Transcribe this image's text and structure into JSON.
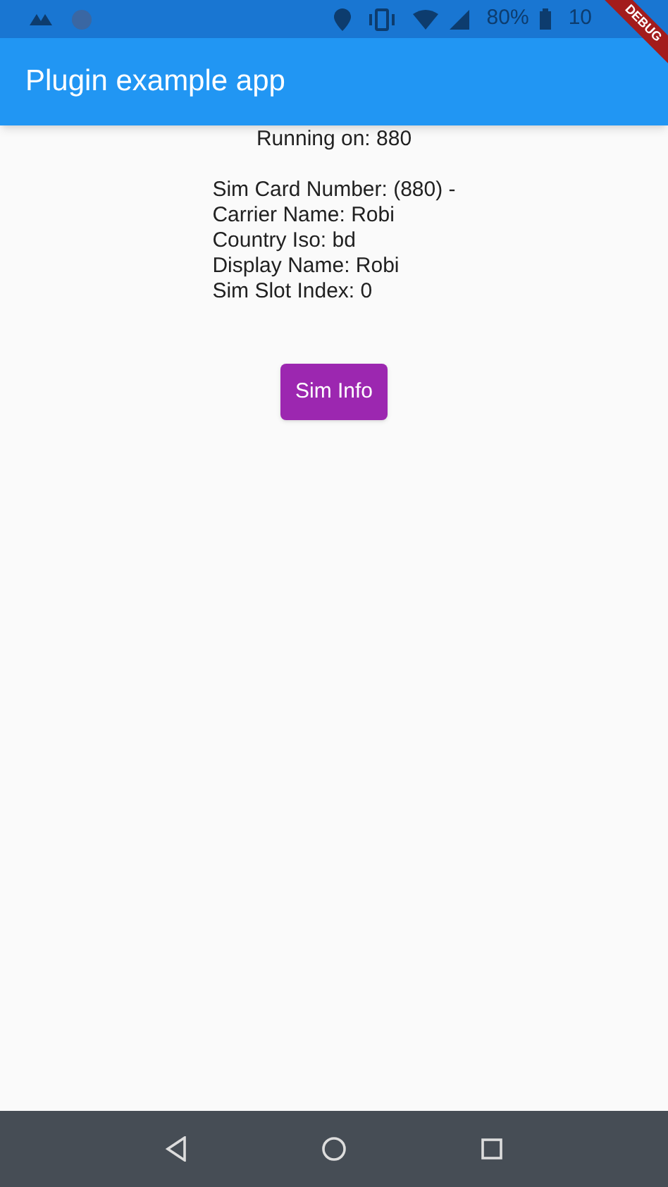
{
  "status_bar": {
    "battery": "80%",
    "time": "10"
  },
  "debug_banner": "DEBUG",
  "app_bar": {
    "title": "Plugin example app"
  },
  "running_on": "Running on: 880",
  "sim_info": [
    "Sim Card Number: (880) -",
    "Carrier Name: Robi",
    "Country Iso: bd",
    "Display Name: Robi",
    "Sim Slot Index: 0"
  ],
  "button": "Sim Info"
}
